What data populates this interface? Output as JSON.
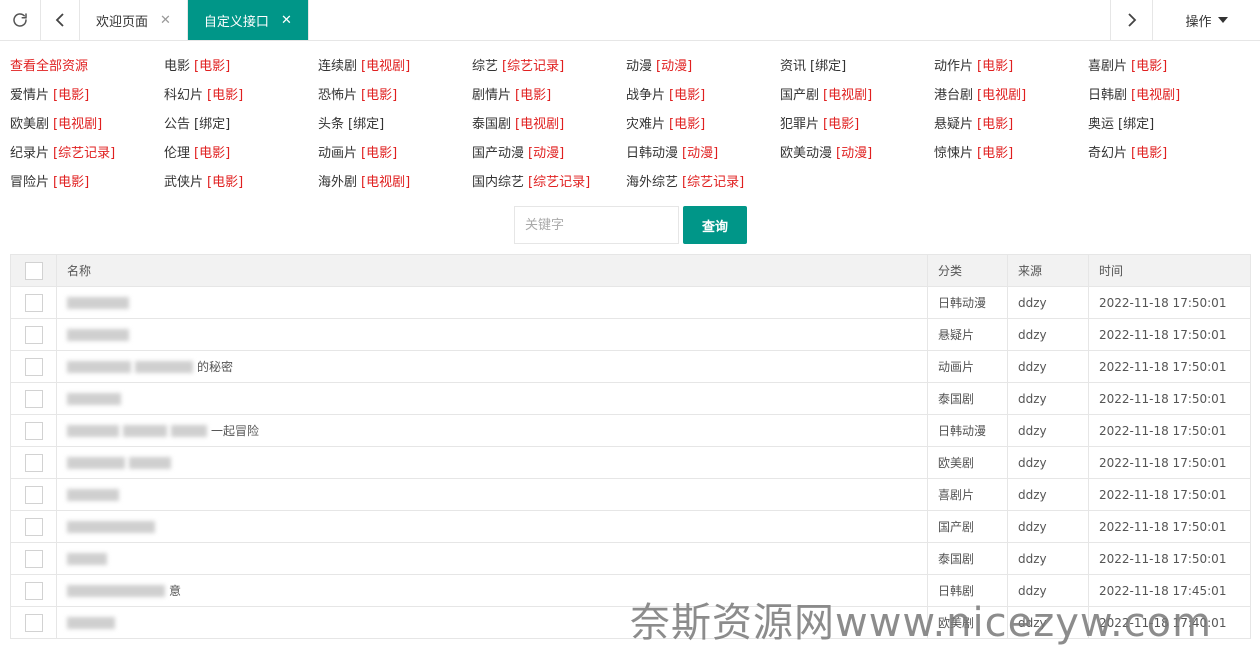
{
  "tabs": [
    {
      "label": "欢迎页面",
      "active": false
    },
    {
      "label": "自定义接口",
      "active": true
    }
  ],
  "toolbar": {
    "ops_label": "操作"
  },
  "categories": [
    [
      {
        "name": "查看全部资源",
        "tag": ""
      },
      {
        "name": "电影",
        "tag": "[电影]"
      },
      {
        "name": "连续剧",
        "tag": "[电视剧]"
      },
      {
        "name": "综艺",
        "tag": "[综艺记录]"
      },
      {
        "name": "动漫",
        "tag": "[动漫]"
      },
      {
        "name": "资讯",
        "tag": "[绑定]"
      },
      {
        "name": "动作片",
        "tag": "[电影]"
      },
      {
        "name": "喜剧片",
        "tag": "[电影]"
      }
    ],
    [
      {
        "name": "爱情片",
        "tag": "[电影]"
      },
      {
        "name": "科幻片",
        "tag": "[电影]"
      },
      {
        "name": "恐怖片",
        "tag": "[电影]"
      },
      {
        "name": "剧情片",
        "tag": "[电影]"
      },
      {
        "name": "战争片",
        "tag": "[电影]"
      },
      {
        "name": "国产剧",
        "tag": "[电视剧]"
      },
      {
        "name": "港台剧",
        "tag": "[电视剧]"
      },
      {
        "name": "日韩剧",
        "tag": "[电视剧]"
      }
    ],
    [
      {
        "name": "欧美剧",
        "tag": "[电视剧]"
      },
      {
        "name": "公告",
        "tag": "[绑定]"
      },
      {
        "name": "头条",
        "tag": "[绑定]"
      },
      {
        "name": "泰国剧",
        "tag": "[电视剧]"
      },
      {
        "name": "灾难片",
        "tag": "[电影]"
      },
      {
        "name": "犯罪片",
        "tag": "[电影]"
      },
      {
        "name": "悬疑片",
        "tag": "[电影]"
      },
      {
        "name": "奥运",
        "tag": "[绑定]"
      }
    ],
    [
      {
        "name": "纪录片",
        "tag": "[综艺记录]"
      },
      {
        "name": "伦理",
        "tag": "[电影]"
      },
      {
        "name": "动画片",
        "tag": "[电影]"
      },
      {
        "name": "国产动漫",
        "tag": "[动漫]"
      },
      {
        "name": "日韩动漫",
        "tag": "[动漫]"
      },
      {
        "name": "欧美动漫",
        "tag": "[动漫]"
      },
      {
        "name": "惊悚片",
        "tag": "[电影]"
      },
      {
        "name": "奇幻片",
        "tag": "[电影]"
      }
    ],
    [
      {
        "name": "冒险片",
        "tag": "[电影]"
      },
      {
        "name": "武侠片",
        "tag": "[电影]"
      },
      {
        "name": "海外剧",
        "tag": "[电视剧]"
      },
      {
        "name": "国内综艺",
        "tag": "[综艺记录]"
      },
      {
        "name": "海外综艺",
        "tag": "[综艺记录]"
      }
    ]
  ],
  "search": {
    "placeholder": "关键字",
    "button_label": "查询"
  },
  "table": {
    "headers": {
      "name": "名称",
      "category": "分类",
      "source": "来源",
      "time": "时间"
    },
    "rows": [
      {
        "name_visible": "",
        "category": "日韩动漫",
        "source": "ddzy",
        "time": "2022-11-18 17:50:01"
      },
      {
        "name_visible": "",
        "category": "悬疑片",
        "source": "ddzy",
        "time": "2022-11-18 17:50:01"
      },
      {
        "name_visible": "的秘密",
        "category": "动画片",
        "source": "ddzy",
        "time": "2022-11-18 17:50:01"
      },
      {
        "name_visible": "",
        "category": "泰国剧",
        "source": "ddzy",
        "time": "2022-11-18 17:50:01"
      },
      {
        "name_visible": "一起冒险",
        "category": "日韩动漫",
        "source": "ddzy",
        "time": "2022-11-18 17:50:01"
      },
      {
        "name_visible": "",
        "category": "欧美剧",
        "source": "ddzy",
        "time": "2022-11-18 17:50:01"
      },
      {
        "name_visible": "",
        "category": "喜剧片",
        "source": "ddzy",
        "time": "2022-11-18 17:50:01"
      },
      {
        "name_visible": "",
        "category": "国产剧",
        "source": "ddzy",
        "time": "2022-11-18 17:50:01"
      },
      {
        "name_visible": "",
        "category": "泰国剧",
        "source": "ddzy",
        "time": "2022-11-18 17:50:01"
      },
      {
        "name_visible": "意",
        "category": "日韩剧",
        "source": "ddzy",
        "time": "2022-11-18 17:45:01"
      },
      {
        "name_visible": "",
        "category": "欧美剧",
        "source": "ddzy",
        "time": "2022-11-18 17:40:01"
      }
    ]
  },
  "watermark": "奈斯资源网www.nicezyw.com"
}
